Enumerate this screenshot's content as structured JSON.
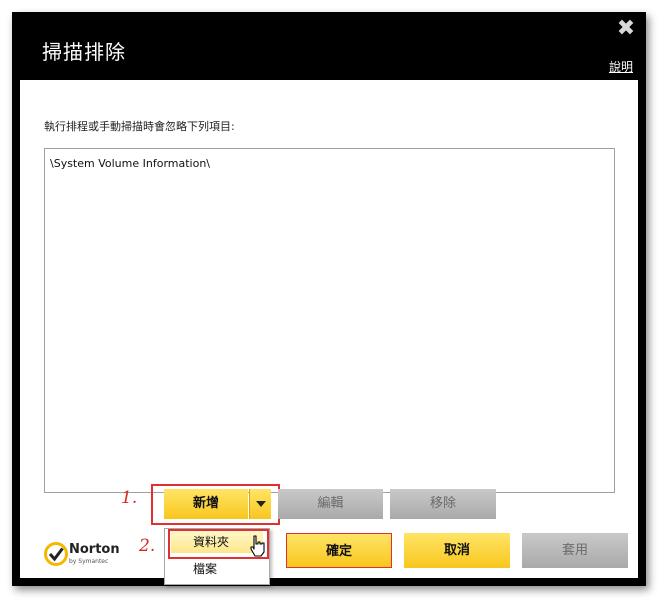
{
  "window": {
    "title": "掃描排除",
    "help_label": "說明",
    "close_glyph": "✖"
  },
  "instruction": "執行排程或手動掃描時會忽略下列項目:",
  "exclusions": [
    "\\System Volume Information\\"
  ],
  "actions": {
    "add_label": "新增",
    "edit_label": "編輯",
    "remove_label": "移除"
  },
  "add_menu": {
    "items": [
      "資料夾",
      "檔案"
    ]
  },
  "footer": {
    "ok_label": "確定",
    "cancel_label": "取消",
    "apply_label": "套用"
  },
  "annotations": {
    "step1": "1.",
    "step2": "2."
  },
  "logo": {
    "name": "Norton",
    "byline": "by Symantec"
  },
  "colors": {
    "titlebar": "#000000",
    "button_primary": "#f8c71d",
    "button_disabled": "#b4b4b4",
    "annotation_red": "#e03030"
  }
}
